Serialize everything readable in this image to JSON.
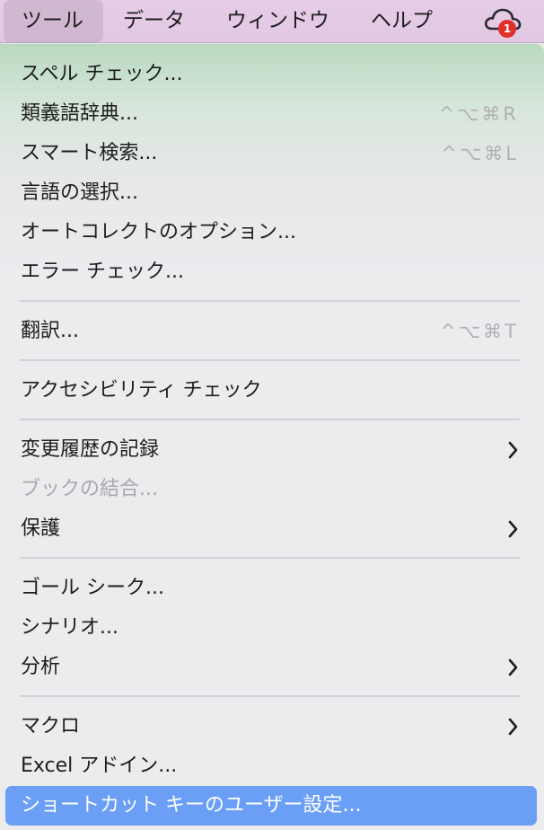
{
  "menubar": {
    "items": [
      {
        "label": "ツール",
        "active": true
      },
      {
        "label": "データ"
      },
      {
        "label": "ウィンドウ"
      },
      {
        "label": "ヘルプ"
      }
    ],
    "cloud_icon": "cloud-icon",
    "badge_count": "1",
    "badge_color": "#e0302a"
  },
  "menu": {
    "items": [
      {
        "label": "スペル チェック..."
      },
      {
        "label": "類義語辞典...",
        "shortcut": "^⌥⌘R"
      },
      {
        "label": "スマート検索...",
        "shortcut": "^⌥⌘L"
      },
      {
        "label": "言語の選択..."
      },
      {
        "label": "オートコレクトのオプション..."
      },
      {
        "label": "エラー チェック..."
      },
      {
        "label": "翻訳...",
        "shortcut": "^⌥⌘T"
      },
      {
        "label": "アクセシビリティ チェック"
      },
      {
        "label": "変更履歴の記録",
        "submenu": true
      },
      {
        "label": "ブックの結合...",
        "disabled": true
      },
      {
        "label": "保護",
        "submenu": true
      },
      {
        "label": "ゴール シーク..."
      },
      {
        "label": "シナリオ..."
      },
      {
        "label": "分析",
        "submenu": true
      },
      {
        "label": "マクロ",
        "submenu": true
      },
      {
        "label": "Excel アドイン..."
      },
      {
        "label": "ショートカット キーのユーザー設定...",
        "highlighted": true
      }
    ],
    "highlight_color": "#6a9ff5"
  }
}
